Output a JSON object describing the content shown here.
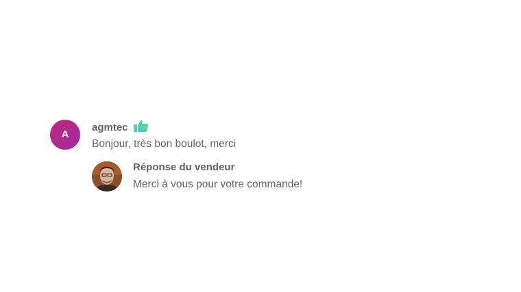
{
  "review": {
    "avatar_letter": "A",
    "username": "agmtec",
    "rating_icon": "thumbs-up-icon",
    "text": "Bonjour, très bon boulot, merci",
    "seller_reply": {
      "avatar_icon": "seller-photo",
      "heading": "Réponse du vendeur",
      "text": "Merci à vous pour votre commande!"
    }
  },
  "colors": {
    "avatar_bg": "#b9288f",
    "thumb": "#4fd1b0",
    "text": "#62646a"
  }
}
